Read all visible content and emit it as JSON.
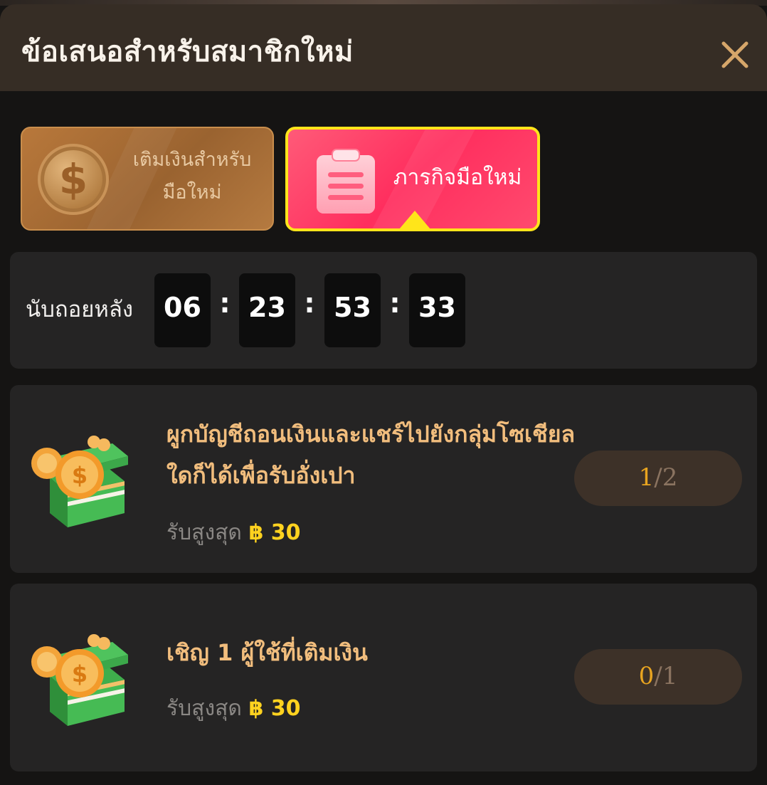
{
  "dialog": {
    "title": "ข้อเสนอสำหรับสมาชิกใหม่",
    "close_icon": "close-icon"
  },
  "tabs": [
    {
      "label_line1": "เติมเงินสำหรับ",
      "label_line2": "มือใหม่",
      "icon": "dollar-coin-icon",
      "selected": false
    },
    {
      "label": "ภารกิจมือใหม่",
      "icon": "clipboard-icon",
      "selected": true
    }
  ],
  "countdown": {
    "label": "นับถอยหลัง",
    "hours": "06",
    "minutes": "23",
    "seconds": "53",
    "centiseconds": "33",
    "separator": ":"
  },
  "missions": [
    {
      "title": "ผูกบัญชีถอนเงินและแชร์ไปยังกลุ่มโซเชียลใดก็ได้เพื่อรับอั่งเปา",
      "reward_label": "รับสูงสุด",
      "reward_amount": "฿ 30",
      "progress_current": "1",
      "progress_total": "/2",
      "icon": "gift-box-coin-icon"
    },
    {
      "title": "เชิญ 1 ผู้ใช้ที่เติมเงิน",
      "reward_label": "รับสูงสุด",
      "reward_amount": "฿ 30",
      "progress_current": "0",
      "progress_total": "/1",
      "icon": "gift-box-coin-icon"
    }
  ],
  "colors": {
    "header_bg": "#362d25",
    "active_tab": "#ff2e5e",
    "active_border": "#ffe51a",
    "mission_title": "#f1bd7d",
    "reward_amount": "#ffd21f"
  }
}
